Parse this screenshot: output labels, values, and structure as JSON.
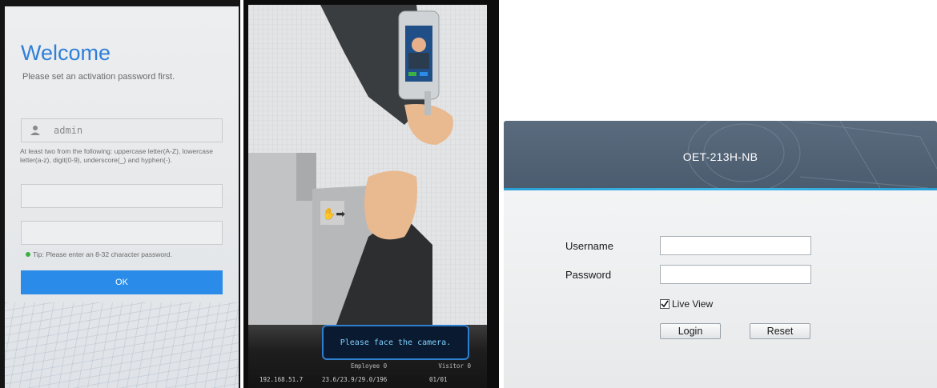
{
  "activation": {
    "title": "Welcome",
    "subtitle": "Please set an activation password first.",
    "username_value": "admin",
    "password_rule": "At least two from the following: uppercase letter(A-Z), lowercase letter(a-z), digit(0-9), underscore(_) and hyphen(-).",
    "tip": "Tip: Please enter an 8-32 character password.",
    "ok_label": "OK",
    "accent_color": "#2f7fd8",
    "button_color": "#2a8ce8"
  },
  "terminal": {
    "message": "Please face the camera.",
    "employee_label": "Employee",
    "employee_count": "0",
    "visitor_label": "Visitor",
    "visitor_count": "0",
    "ip": "192.168.51.7",
    "temperature": "23.6/23.9/29.0/196",
    "date": "01/01",
    "highlight_color": "#2f7fd0"
  },
  "login": {
    "device_name": "OET-213H-NB",
    "username_label": "Username",
    "password_label": "Password",
    "username_value": "",
    "password_value": "",
    "live_view_label": "Live View",
    "live_view_checked": true,
    "login_label": "Login",
    "reset_label": "Reset",
    "header_color": "#4b5c6f",
    "accent_color": "#2a9fd6"
  }
}
